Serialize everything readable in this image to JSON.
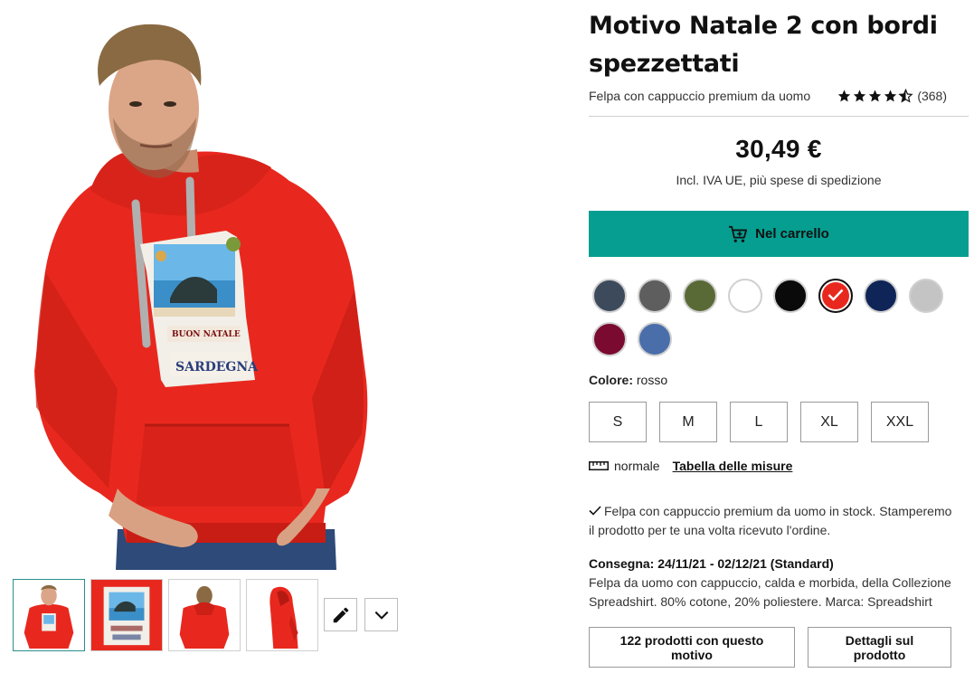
{
  "product": {
    "title": "Motivo Natale 2 con bordi spezzettati",
    "subtitle": "Felpa con cappuccio premium da uomo",
    "rating": {
      "stars": 4.5,
      "count": "(368)"
    },
    "price": "30,49 €",
    "tax_note": "Incl. IVA UE, più spese di spedizione",
    "cart_label": "Nel carrello"
  },
  "design_text": {
    "line1": "BUON NATALE",
    "line2": "SARDEGNA"
  },
  "colors": {
    "accent": "#069e90",
    "product_red": "#e8281e",
    "swatches": [
      {
        "name": "blu grigiastro",
        "hex": "#3c4a5c"
      },
      {
        "name": "grigio scuro",
        "hex": "#5e5e5e"
      },
      {
        "name": "verde oliva",
        "hex": "#5a6a36"
      },
      {
        "name": "bianco",
        "hex": "#ffffff"
      },
      {
        "name": "nero",
        "hex": "#0a0a0a"
      },
      {
        "name": "rosso",
        "hex": "#e8281e",
        "selected": true
      },
      {
        "name": "blu navy",
        "hex": "#0f2457"
      },
      {
        "name": "grigio chiaro",
        "hex": "#c4c4c4"
      },
      {
        "name": "bordeaux",
        "hex": "#7a0a30"
      },
      {
        "name": "blu royal",
        "hex": "#4a6eaa"
      }
    ]
  },
  "color_selection": {
    "label": "Colore:",
    "value": "rosso"
  },
  "sizes": [
    "S",
    "M",
    "L",
    "XL",
    "XXL"
  ],
  "fit": {
    "label": "normale",
    "size_table_link": "Tabella delle misure"
  },
  "stock_text": "Felpa con cappuccio premium da uomo in stock. Stamperemo il prodotto per te una volta ricevuto l'ordine.",
  "delivery": {
    "label": "Consegna: 24/11/21 - 02/12/21 (Standard)",
    "description": "Felpa da uomo con cappuccio, calda e morbida, della Collezione Spreadshirt. 80% cotone, 20% poliestere. Marca: Spreadshirt"
  },
  "buttons": {
    "more_products": "122 prodotti con questo motivo",
    "details": "Dettagli sul prodotto"
  },
  "icons": {
    "cart": "cart-icon",
    "check": "check-icon",
    "ruler": "ruler-icon",
    "edit": "pencil-icon",
    "expand": "chevron-down-icon",
    "star": "star-icon"
  }
}
